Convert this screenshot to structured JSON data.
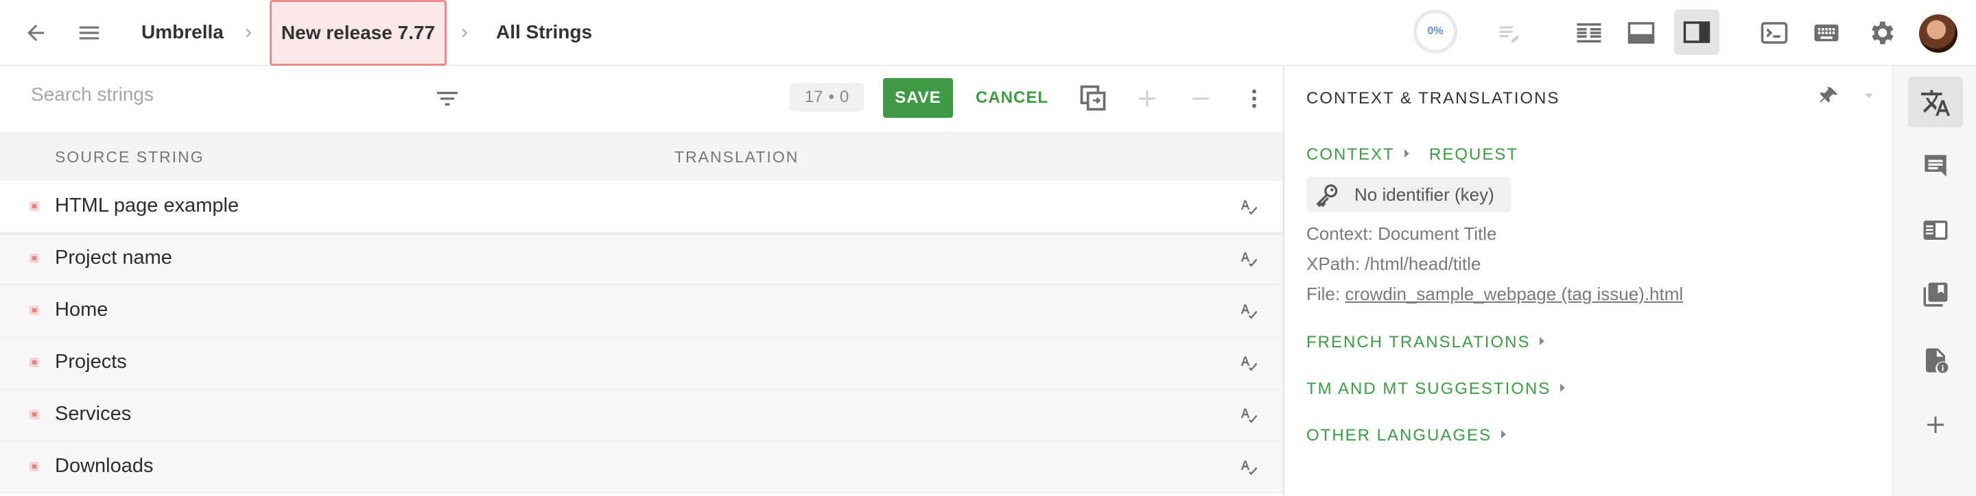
{
  "topbar": {
    "breadcrumb": [
      {
        "label": "Umbrella"
      },
      {
        "label": "New release 7.77"
      },
      {
        "label": "All Strings"
      }
    ],
    "progress": "0%"
  },
  "toolbar": {
    "search_placeholder": "Search strings",
    "counter_left": "17",
    "counter_sep": "•",
    "counter_right": "0",
    "save_label": "SAVE",
    "cancel_label": "CANCEL"
  },
  "table": {
    "headers": {
      "source": "SOURCE STRING",
      "translation": "TRANSLATION"
    },
    "rows": [
      {
        "source": "HTML page example"
      },
      {
        "source": "Project name"
      },
      {
        "source": "Home"
      },
      {
        "source": "Projects"
      },
      {
        "source": "Services"
      },
      {
        "source": "Downloads"
      }
    ]
  },
  "context_panel": {
    "title": "CONTEXT & TRANSLATIONS",
    "context_label": "CONTEXT",
    "request_label": "REQUEST",
    "identifier": "No identifier (key)",
    "context_prefix": "Context:",
    "context_value": "Document Title",
    "xpath_prefix": "XPath:",
    "xpath_value": "/html/head/title",
    "file_prefix": "File:",
    "file_value": "crowdin_sample_webpage (tag issue).html",
    "sections": [
      {
        "label": "FRENCH TRANSLATIONS"
      },
      {
        "label": "TM AND MT SUGGESTIONS"
      },
      {
        "label": "OTHER LANGUAGES"
      }
    ]
  },
  "colors": {
    "accent_green": "#3e9a45",
    "highlight_red": "#f08a8a",
    "progress_blue": "#5b93d6"
  }
}
